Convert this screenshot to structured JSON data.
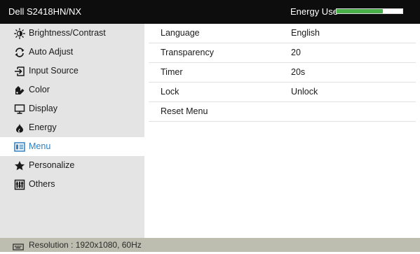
{
  "title": {
    "model": "Dell S2418HN/NX",
    "energy_label": "Energy Use",
    "energy_level": 0.7,
    "energy_color": "#49b049"
  },
  "sidebar": {
    "items": [
      {
        "label": "Brightness/Contrast",
        "icon": "brightness-icon"
      },
      {
        "label": "Auto Adjust",
        "icon": "auto-adjust-icon"
      },
      {
        "label": "Input Source",
        "icon": "input-source-icon"
      },
      {
        "label": "Color",
        "icon": "color-icon"
      },
      {
        "label": "Display",
        "icon": "display-icon"
      },
      {
        "label": "Energy",
        "icon": "energy-icon"
      },
      {
        "label": "Menu",
        "icon": "menu-icon",
        "active": true
      },
      {
        "label": "Personalize",
        "icon": "star-icon"
      },
      {
        "label": "Others",
        "icon": "others-icon"
      }
    ]
  },
  "main": {
    "rows": [
      {
        "name": "Language",
        "value": "English"
      },
      {
        "name": "Transparency",
        "value": "20"
      },
      {
        "name": "Timer",
        "value": "20s"
      },
      {
        "name": "Lock",
        "value": "Unlock"
      },
      {
        "name": "Reset Menu",
        "value": ""
      }
    ]
  },
  "status": {
    "icon": "resolution-icon",
    "text": "Resolution : 1920x1080, 60Hz"
  },
  "colors": {
    "accent": "#2f7fc1",
    "titlebar": "#0d0d0d",
    "sidebar": "#e4e4e4",
    "statusbar": "#bdbdb0"
  }
}
